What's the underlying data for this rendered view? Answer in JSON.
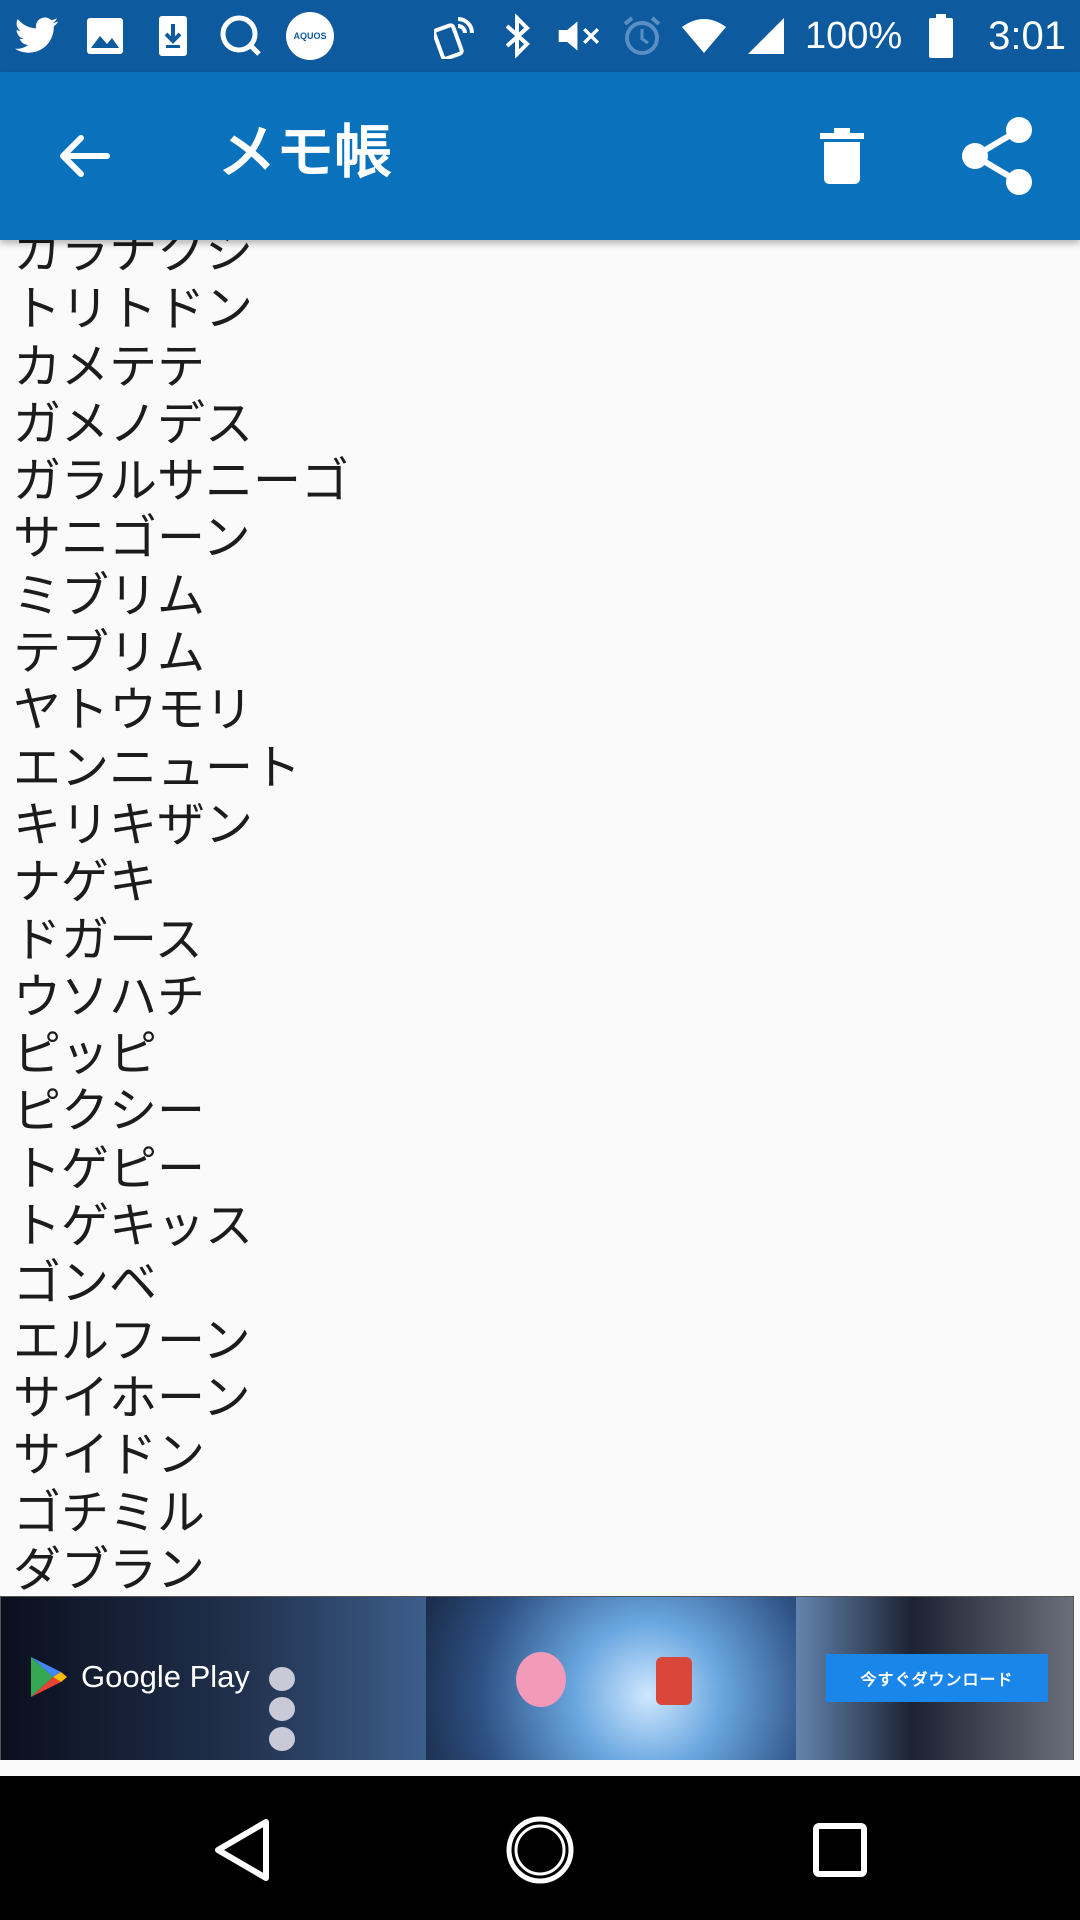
{
  "status_bar": {
    "icons": [
      "twitter-icon",
      "image-icon",
      "download-icon",
      "chat-bubble-icon",
      "aquos-icon",
      "nfc-icon",
      "bluetooth-icon",
      "volume-mute-icon",
      "alarm-icon",
      "wifi-icon",
      "cell-signal-icon",
      "battery-icon"
    ],
    "aquos_label": "AQUOS",
    "battery": "100%",
    "time": "3:01"
  },
  "app_bar": {
    "title": "メモ帳",
    "back_icon": "arrow-back-icon",
    "delete_icon": "trash-icon",
    "share_icon": "share-icon",
    "background": "#0a72bd"
  },
  "memo": {
    "lines": [
      "カラナクシ",
      "トリトドン",
      "カメテテ",
      "ガメノデス",
      "ガラルサニーゴ",
      "サニゴーン",
      "ミブリム",
      "テブリム",
      "ヤトウモリ",
      "エンニュート",
      "キリキザン",
      "ナゲキ",
      "ドガース",
      "ウソハチ",
      "ピッピ",
      "ピクシー",
      "トゲピー",
      "トゲキッス",
      "ゴンベ",
      "エルフーン",
      "サイホーン",
      "サイドン",
      "ゴチミル",
      "ダブラン"
    ]
  },
  "ad": {
    "logo_text": "Google Play",
    "cta_label": "今すぐダウンロード",
    "cta_color": "#1b86ea"
  },
  "nav_bar": {
    "back_icon": "nav-back-icon",
    "home_icon": "nav-home-icon",
    "recents_icon": "nav-recents-icon"
  }
}
